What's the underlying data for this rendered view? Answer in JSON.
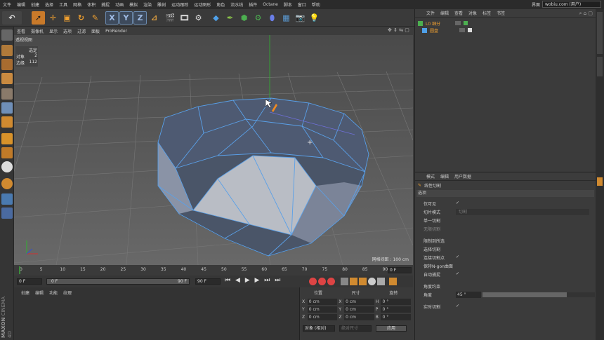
{
  "menu": [
    "文件",
    "编辑",
    "创建",
    "选择",
    "工具",
    "网格",
    "体积",
    "捕捉",
    "动画",
    "模拟",
    "渲染",
    "雕刻",
    "运动跟踪",
    "运动图形",
    "角色",
    "流水线",
    "插件",
    "Octane",
    "脚本",
    "窗口",
    "帮助"
  ],
  "layout": {
    "label": "界面",
    "value": "wobiu.com (用户)"
  },
  "toolbar": {
    "x": "X",
    "y": "Y",
    "z": "Z"
  },
  "viewport": {
    "menu": [
      "查看",
      "摄像机",
      "显示",
      "选项",
      "过滤",
      "面板",
      "ProRender"
    ],
    "view_name": "透视视图",
    "hud_title": "选定",
    "hud_rows": [
      {
        "label": "对象",
        "value": "2"
      },
      {
        "label": "边缘",
        "value": "112"
      }
    ],
    "grid_label": "网格间距 : 100 cm",
    "colors": {
      "accent": "#4a90e0"
    }
  },
  "timeline": {
    "ticks": [
      "0",
      "5",
      "10",
      "15",
      "20",
      "25",
      "30",
      "35",
      "40",
      "45",
      "50",
      "55",
      "60",
      "65",
      "70",
      "75",
      "80",
      "85",
      "90"
    ],
    "end_frame": "0 F"
  },
  "controls": {
    "start": "0 F",
    "slider": "0 F",
    "slider_end": "90 F",
    "end": "90 F"
  },
  "bottom": {
    "menu": [
      "创建",
      "编辑",
      "功能",
      "纹理"
    ]
  },
  "coords": {
    "headers": [
      "位置",
      "尺寸",
      "旋转"
    ],
    "rows": [
      {
        "a": "X",
        "av": "0 cm",
        "b": "X",
        "bv": "0 cm",
        "c": "H",
        "cv": "0 °"
      },
      {
        "a": "Y",
        "av": "0 cm",
        "b": "Y",
        "bv": "0 cm",
        "c": "P",
        "cv": "0 °"
      },
      {
        "a": "Z",
        "av": "0 cm",
        "b": "Z",
        "bv": "0 cm",
        "c": "B",
        "cv": "0 °"
      }
    ],
    "mode": "对象 (相对)",
    "size_mode": "绝对尺寸",
    "apply": "应用"
  },
  "objects": {
    "menu": [
      "文件",
      "编辑",
      "查看",
      "对象",
      "标签",
      "书签"
    ],
    "items": [
      {
        "name": "L0 细分"
      },
      {
        "name": "圆盘"
      }
    ]
  },
  "attributes": {
    "menu": [
      "模式",
      "编辑",
      "用户数据"
    ],
    "tool": "线性切割",
    "section": "选项",
    "rows": [
      {
        "label": "仅可见",
        "value": "✓"
      },
      {
        "label": "切片模式",
        "value": "切割"
      },
      {
        "label": "单一切割",
        "value": ""
      },
      {
        "label": "无限切割",
        "value": ""
      },
      {
        "label": "限制到所选",
        "value": ""
      },
      {
        "label": "选择切割",
        "value": ""
      },
      {
        "label": "连接切割点",
        "value": "✓"
      },
      {
        "label": "保持N-gon曲面",
        "value": ""
      },
      {
        "label": "自动捕捉",
        "value": "✓"
      },
      {
        "label": "角度约束",
        "value": ""
      },
      {
        "label": "角度",
        "value": "45 °"
      },
      {
        "label": "实时切割",
        "value": "✓"
      }
    ]
  },
  "brand": {
    "maxon": "MAXON",
    "product": "CINEMA 4D"
  }
}
